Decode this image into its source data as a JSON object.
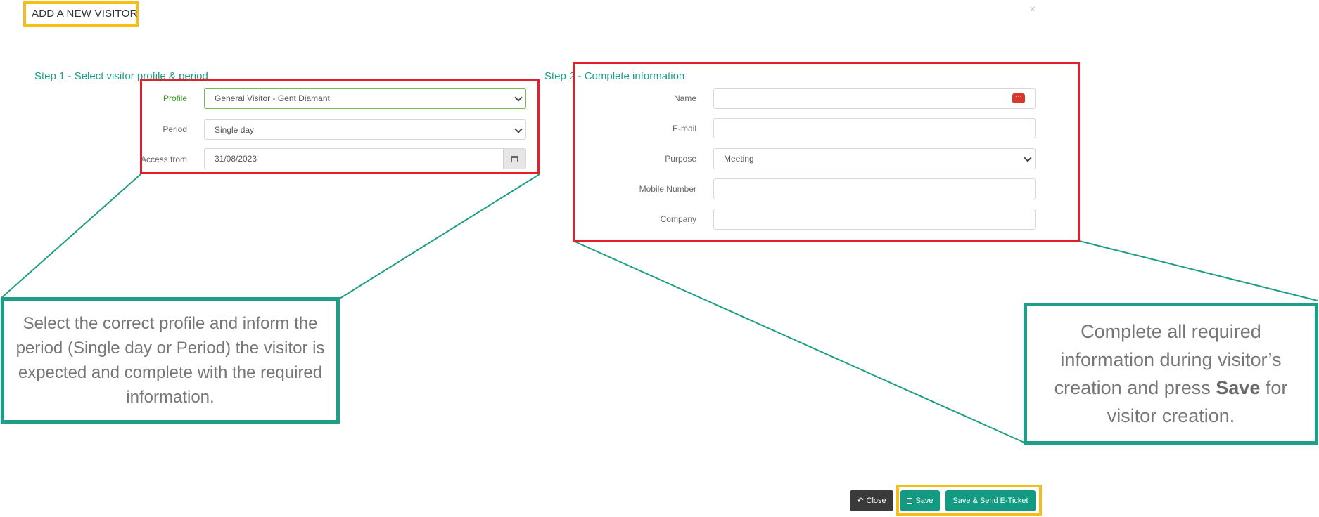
{
  "modal": {
    "title": "ADD A NEW VISITOR",
    "close_symbol": "×"
  },
  "step1": {
    "title": "Step 1 - Select visitor profile & period",
    "profile_label": "Profile",
    "profile_value": "General Visitor - Gent Diamant",
    "period_label": "Period",
    "period_value": "Single day",
    "access_label": "Access from",
    "access_value": "31/08/2023"
  },
  "step2": {
    "title": "Step 2 - Complete information",
    "name_label": "Name",
    "email_label": "E-mail",
    "purpose_label": "Purpose",
    "purpose_value": "Meeting",
    "mobile_label": "Mobile Number",
    "company_label": "Company",
    "name_value": "",
    "email_value": "",
    "mobile_value": "",
    "company_value": ""
  },
  "callouts": {
    "left": "Select the correct profile and inform the period (Single day or Period) the visitor is expected and complete with the required information.",
    "right_pre": "Complete all required information during visitor’s creation and press ",
    "right_bold": "Save",
    "right_post": " for visitor creation."
  },
  "footer": {
    "close_label": "Close",
    "save_label": "Save",
    "save_send_label": "Save & Send E-Ticket"
  },
  "icons": {
    "calendar": "calendar-icon",
    "more": "more-dots-icon",
    "undo": "undo-icon",
    "save": "floppy-icon"
  },
  "colors": {
    "accent_teal": "#129a83",
    "highlight_yellow": "#f6be15",
    "annotation_red": "#e41f2a",
    "profile_green": "#2ea01a"
  }
}
